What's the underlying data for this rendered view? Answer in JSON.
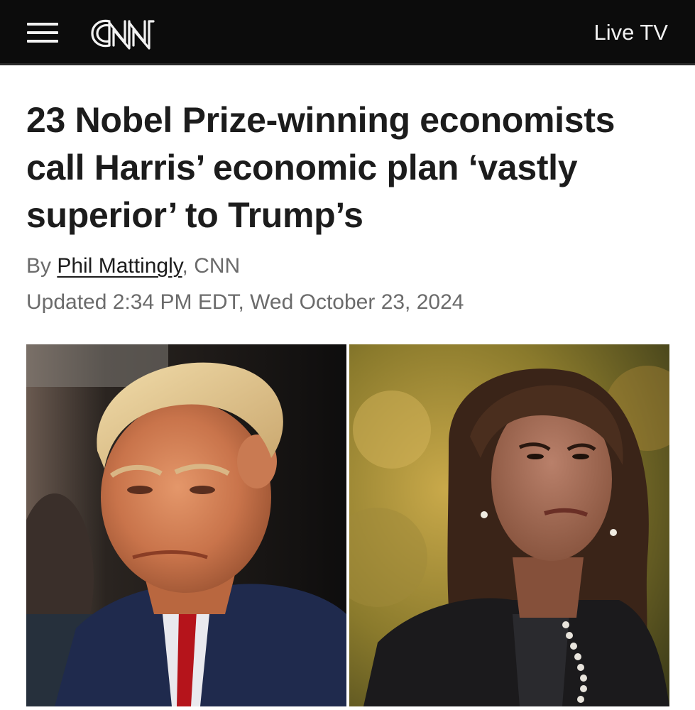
{
  "header": {
    "logo_text": "CNN",
    "live_tv_label": "Live TV",
    "menu_icon": "hamburger-menu-icon"
  },
  "article": {
    "headline": "23 Nobel Prize-winning economists call Harris’ economic plan ‘vastly superior’ to Trump’s",
    "byline_prefix": "By ",
    "author": "Phil Mattingly",
    "byline_suffix": ", CNN",
    "updated": "Updated 2:34 PM EDT, Wed October 23, 2024"
  },
  "colors": {
    "header_bg": "#0c0c0c",
    "header_text": "#f2f2f2",
    "headline_text": "#1c1c1c",
    "meta_text": "#6b6b6b"
  }
}
